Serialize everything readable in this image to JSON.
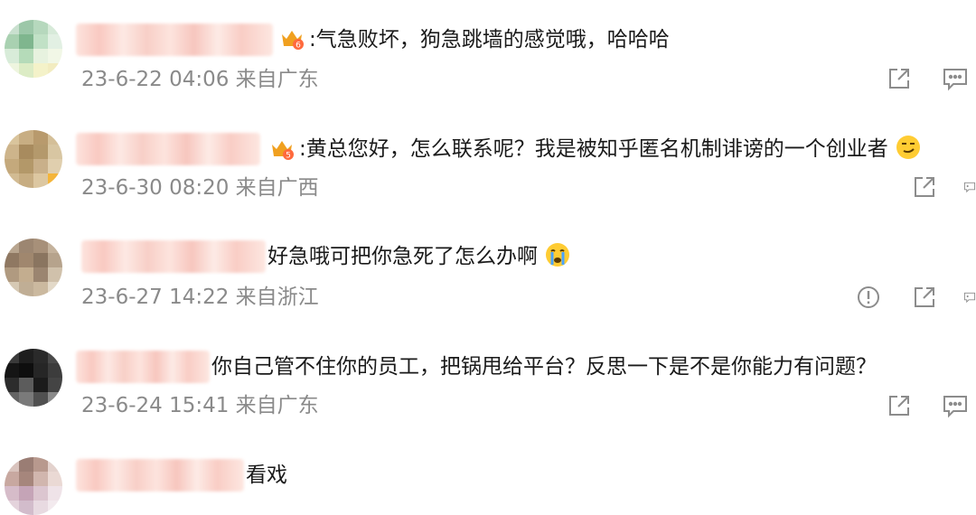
{
  "comments": [
    {
      "text": ":气急败坏，狗急跳墙的感觉哦，哈哈哈",
      "date": "23-6-22 04:06",
      "location": "来自广东"
    },
    {
      "text": ":黄总您好，怎么联系呢？我是被知乎匿名机制诽谤的一个创业者",
      "date": "23-6-30 08:20",
      "location": "来自广西"
    },
    {
      "text": "好急哦可把你急死了怎么办啊",
      "date": "23-6-27 14:22",
      "location": "来自浙江"
    },
    {
      "text": "你自己管不住你的员工，把锅甩给平台？反思一下是不是你能力有问题？",
      "date": "23-6-24 15:41",
      "location": "来自广东"
    },
    {
      "text": "看戏"
    }
  ],
  "icons": {
    "share": "share-icon",
    "reply": "reply-icon",
    "report": "report-icon",
    "crown": "crown-badge-icon"
  },
  "colors": {
    "meta_text": "#8a8a8a",
    "icon_gray": "#8c8c8c",
    "crown_gold": "#f0a020"
  }
}
